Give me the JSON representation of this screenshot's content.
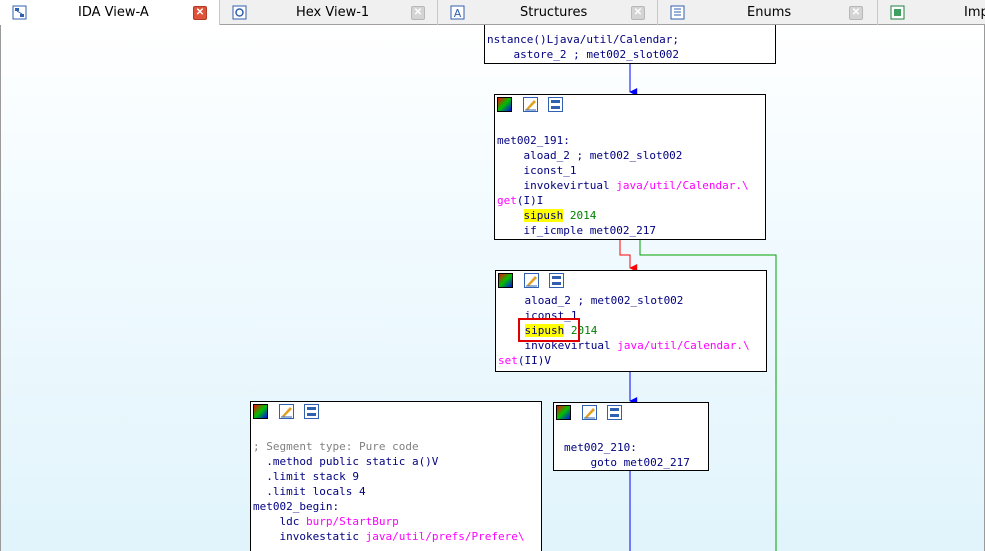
{
  "tabs": [
    {
      "label": "IDA View-A",
      "icon": "graph-view-icon",
      "active": true,
      "close": "red"
    },
    {
      "label": "Hex View-1",
      "icon": "hex-view-icon",
      "active": false,
      "close": "gray"
    },
    {
      "label": "Structures",
      "icon": "structures-icon",
      "active": false,
      "close": "gray"
    },
    {
      "label": "Enums",
      "icon": "enums-icon",
      "active": false,
      "close": "gray"
    },
    {
      "label": "Imp",
      "icon": "imports-icon",
      "active": false,
      "close": null
    }
  ],
  "nodes": {
    "top": {
      "lines": [
        "nstance()Ljava/util/Calendar;",
        "    astore_2 ; met002_slot002"
      ]
    },
    "met191": {
      "label": "met002_191:",
      "aload": "    aload_2 ; met002_slot002",
      "iconst": "    iconst_1",
      "invoke_op": "    invokevirtual ",
      "invoke_ref": "java/util/Calendar.\\",
      "get_ref": "get",
      "get_sig": "(I)I",
      "sipush": "sipush",
      "sipush_val": "2014",
      "ifcmp": "    if_icmple met002_217"
    },
    "setblock": {
      "aload": "    aload_2 ; met002_slot002",
      "iconst": "    iconst_1",
      "sipush": "sipush",
      "sipush_val": "2014",
      "invoke_op": "    invokevirtual ",
      "invoke_ref": "java/util/Calendar.\\",
      "set_ref": "set",
      "set_sig": "(II)V"
    },
    "segment": {
      "comment": "; Segment type: Pure code",
      "method": "  .method public static a()V",
      "stack": "  .limit stack 9",
      "locals": "  .limit locals 4",
      "begin": "met002_begin:",
      "ldc_op": "    ldc ",
      "ldc_ref": "burp/StartBurp",
      "invokestatic_op": "    invokestatic ",
      "invokestatic_ref": "java/util/prefs/Prefere\\"
    },
    "met210": {
      "label": "met002_210:",
      "goto": "    goto met002_217"
    }
  },
  "colors": {
    "edge_normal": "#0000ff",
    "edge_true": "#00a000",
    "edge_false": "#ff0000",
    "highlight": "#ffff00",
    "annotation_box": "#e00000"
  }
}
